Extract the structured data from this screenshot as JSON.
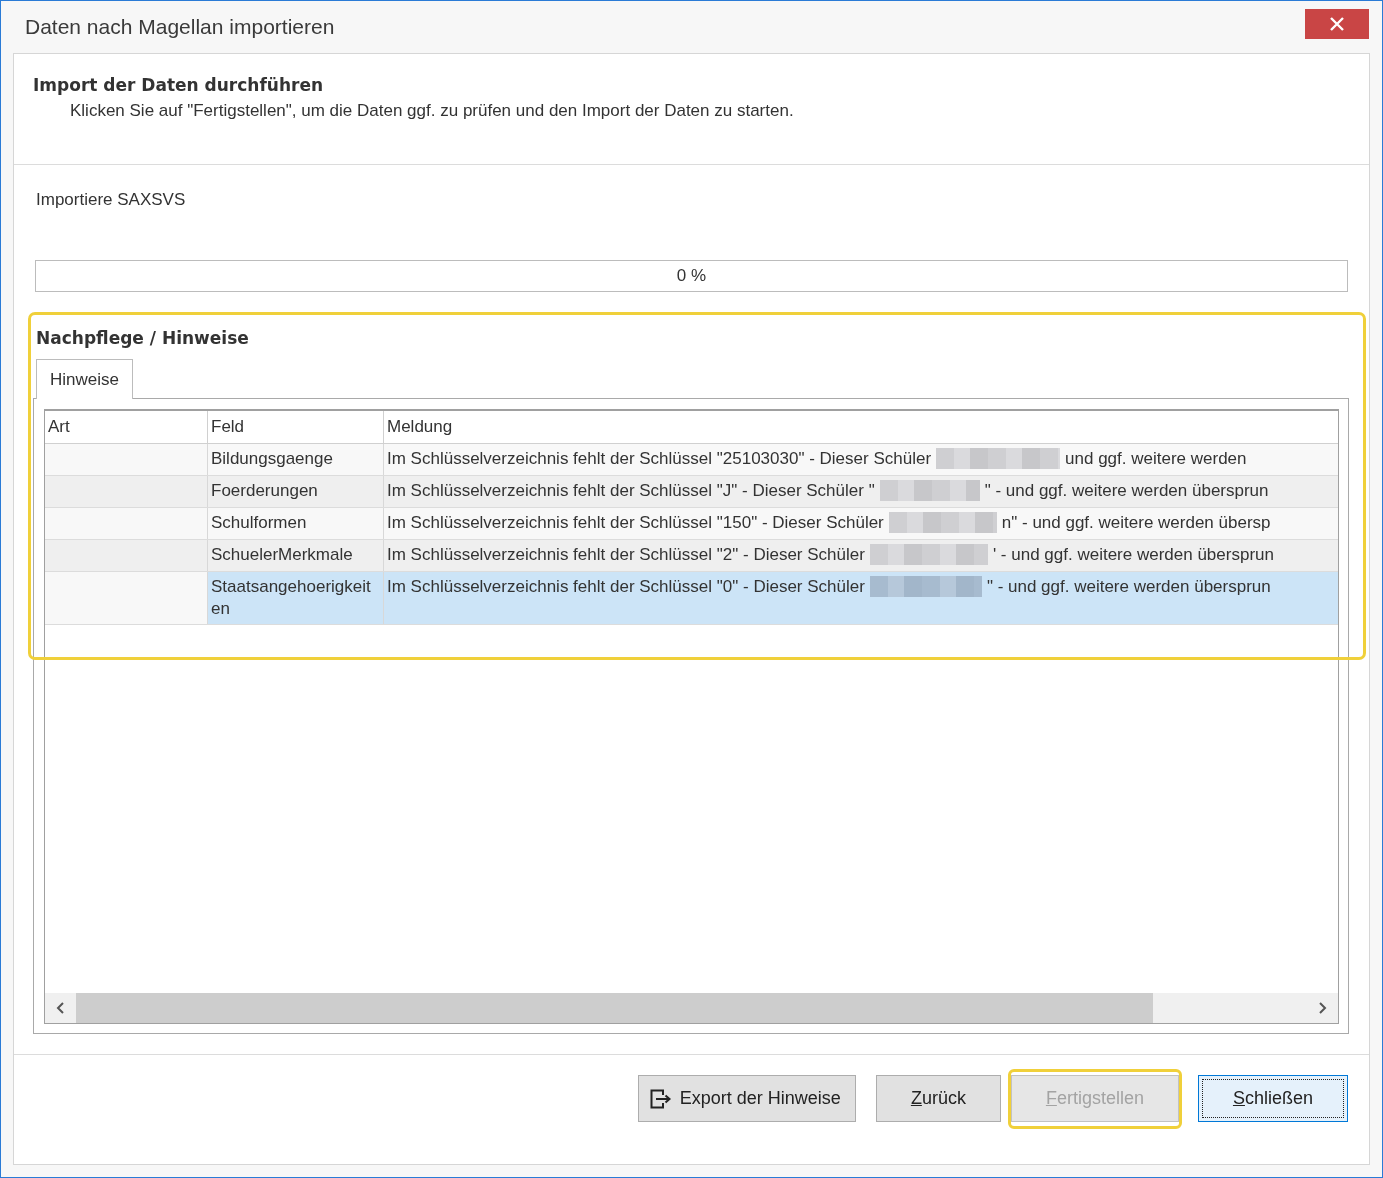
{
  "window": {
    "title": "Daten nach Magellan importieren"
  },
  "header": {
    "title": "Import der Daten durchführen",
    "description": "Klicken Sie auf \"Fertigstellen\", um die Daten ggf. zu prüfen und den Import der Daten zu starten."
  },
  "progress": {
    "label": "Importiere SAXSVS",
    "level": 0,
    "reading": "0 %"
  },
  "notes_group": {
    "title": "Nachpflege / Hinweise",
    "highlighted": true,
    "tabs": [
      {
        "label": "Hinweise",
        "selected": true
      }
    ],
    "table": {
      "columns": [
        "Art",
        "Feld",
        "Meldung"
      ],
      "rows": [
        {
          "feld": "Bildungsgaenge",
          "message": "Im Schlüsselverzeichnis fehlt der Schlüssel \"25103030\" - Dieser Schüler",
          "redacted": true,
          "message_end": "und ggf. weitere werden",
          "selected": false
        },
        {
          "feld": "Foerderungen",
          "message": "Im Schlüsselverzeichnis fehlt der Schlüssel \"J\" - Dieser Schüler \"",
          "redacted": true,
          "message_end": "\" - und ggf. weitere werden übersprun",
          "selected": false
        },
        {
          "feld": "Schulformen",
          "message": "Im Schlüsselverzeichnis fehlt der Schlüssel \"150\" - Dieser Schüler",
          "redacted": true,
          "message_end": "n\" - und ggf. weitere werden übersp",
          "selected": false
        },
        {
          "feld": "SchuelerMerkmale",
          "message": "Im Schlüsselverzeichnis fehlt der Schlüssel \"2\" - Dieser Schüler",
          "redacted": true,
          "message_end": "' - und ggf. weitere werden übersprun",
          "selected": false
        },
        {
          "feld": "Staatsangehoerigkeiten",
          "message": "Im Schlüsselverzeichnis fehlt der Schlüssel \"0\" - Dieser Schüler",
          "redacted": true,
          "message_end": "\" - und ggf. weitere werden übersprun",
          "selected": true
        }
      ]
    }
  },
  "buttons": [
    {
      "label": "Export der Hinweise",
      "kind": "export",
      "underline_first": false,
      "disabled": false,
      "focused": false,
      "highlighted": false
    },
    {
      "label": "Zurück",
      "kind": "plain",
      "underline_first": true,
      "disabled": false,
      "focused": false,
      "highlighted": false
    },
    {
      "label": "Fertigstellen",
      "kind": "plain",
      "underline_first": true,
      "disabled": true,
      "focused": false,
      "highlighted": true
    },
    {
      "label": "Schließen",
      "kind": "plain",
      "underline_first": true,
      "disabled": false,
      "focused": true,
      "highlighted": false
    }
  ]
}
